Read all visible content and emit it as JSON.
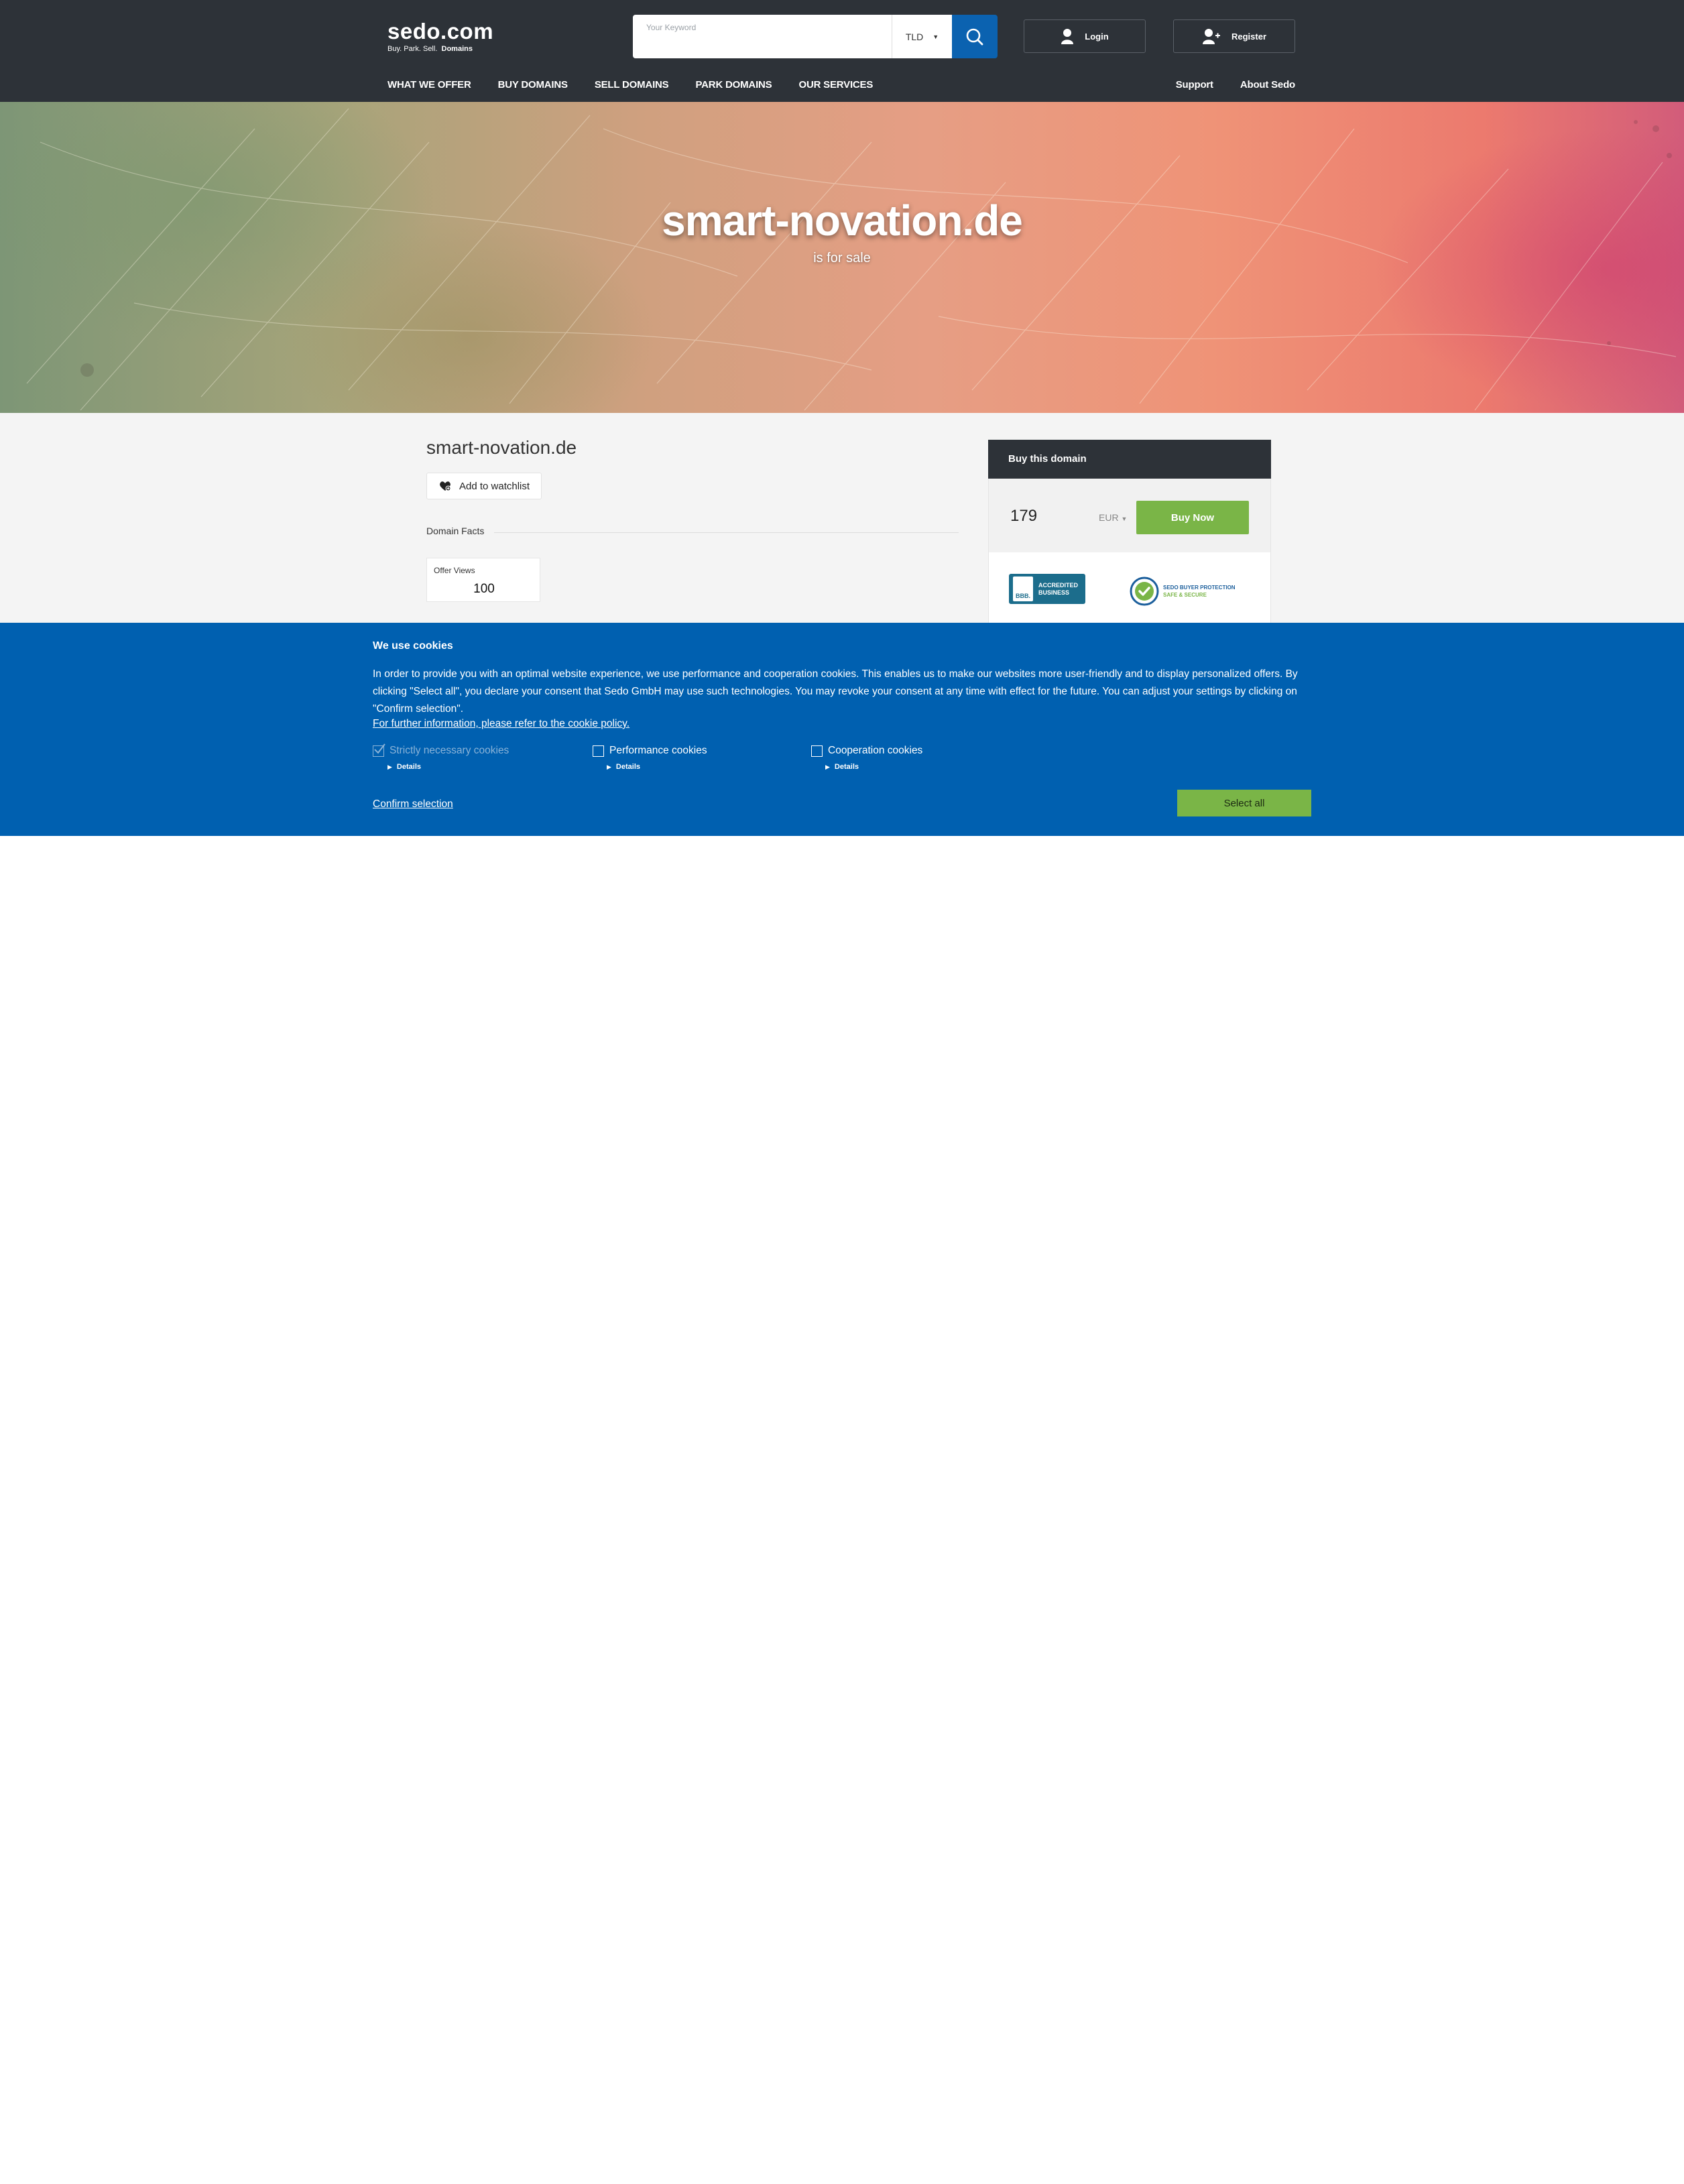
{
  "logo": {
    "main": "sedo.com",
    "tagline_plain": "Buy.  Park.  Sell.",
    "tagline_bold": "Domains"
  },
  "search": {
    "placeholder": "Your Keyword",
    "tld_label": "TLD"
  },
  "auth": {
    "login": "Login",
    "register": "Register"
  },
  "nav": {
    "items": [
      "WHAT WE OFFER",
      "BUY DOMAINS",
      "SELL DOMAINS",
      "PARK DOMAINS",
      "OUR SERVICES"
    ],
    "right": [
      "Support",
      "About Sedo"
    ]
  },
  "hero": {
    "domain": "smart-novation.de",
    "subtitle": "is for sale"
  },
  "listing": {
    "domain": "smart-novation.de",
    "watchlist_label": "Add to watchlist",
    "facts_heading": "Domain Facts",
    "facts": [
      {
        "label": "Offer Views",
        "value": "100"
      }
    ]
  },
  "buy": {
    "heading": "Buy this domain",
    "price": "179",
    "currency": "EUR",
    "button": "Buy Now",
    "bbb": {
      "mark": "BBB.",
      "line1": "ACCREDITED",
      "line2": "BUSINESS"
    },
    "protection": {
      "line1": "SEDO BUYER PROTECTION",
      "line2": "SAFE & SECURE"
    }
  },
  "cookie": {
    "title": "We use cookies",
    "text": "In order to provide you with an optimal website experience, we use performance and cooperation cookies. This enables us to make our websites more user-friendly and to display personalized offers. By clicking \"Select all\", you declare your consent that Sedo GmbH may use such technologies. You may revoke your consent at any time with effect for the future. You can adjust your settings by clicking on \"Confirm selection\".",
    "link": "For further information, please refer to the cookie policy.",
    "options": [
      {
        "label": "Strictly necessary cookies",
        "checked": true,
        "disabled": true
      },
      {
        "label": "Performance cookies",
        "checked": false,
        "disabled": false
      },
      {
        "label": "Cooperation cookies",
        "checked": false,
        "disabled": false
      }
    ],
    "details_label": "Details",
    "confirm_label": "Confirm selection",
    "select_all_label": "Select all"
  },
  "colors": {
    "header_bg": "#2d3238",
    "search_button": "#0b62b0",
    "cookie_bg": "#0060b0",
    "accent_green": "#7ab547"
  }
}
